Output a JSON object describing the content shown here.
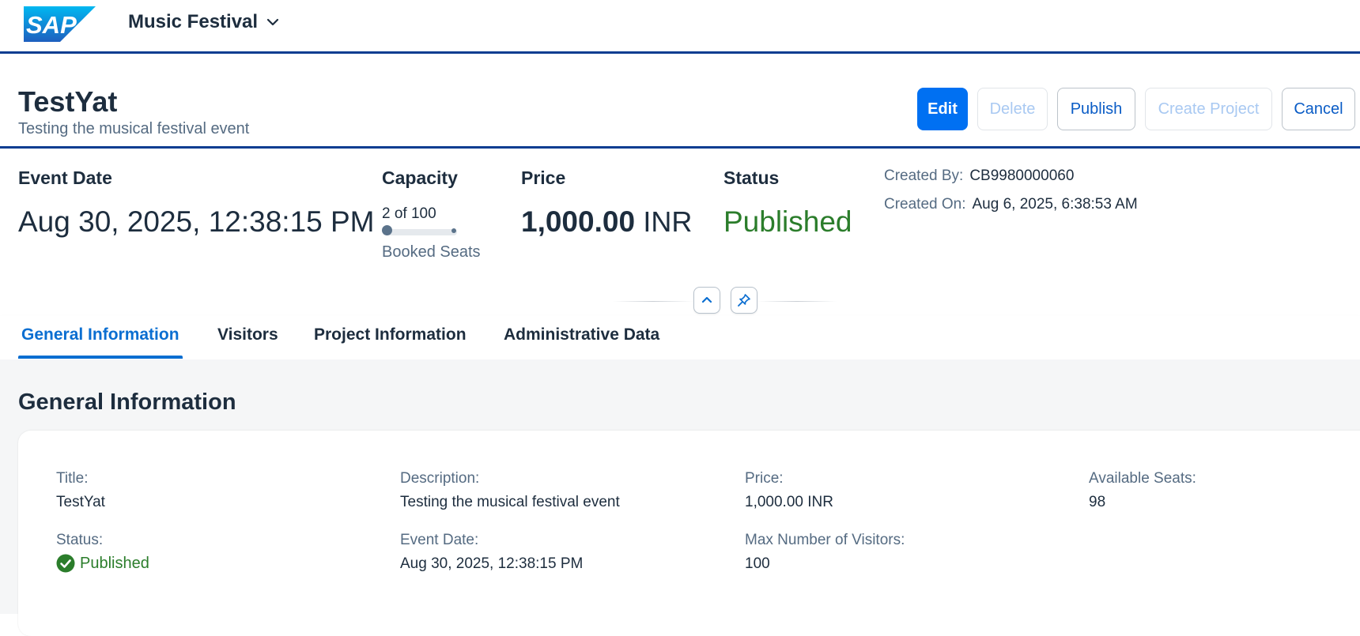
{
  "shell": {
    "logo_text": "SAP",
    "app_title": "Music Festival"
  },
  "header": {
    "title": "TestYat",
    "subtitle": "Testing the musical festival event",
    "actions": {
      "edit": "Edit",
      "delete": "Delete",
      "publish": "Publish",
      "create_project": "Create Project",
      "cancel": "Cancel"
    }
  },
  "kpis": {
    "event_date": {
      "label": "Event Date",
      "value": "Aug 30, 2025, 12:38:15 PM"
    },
    "capacity": {
      "label": "Capacity",
      "text": "2 of 100",
      "booked": 2,
      "total": 100,
      "sublabel": "Booked Seats"
    },
    "price": {
      "label": "Price",
      "amount": "1,000.00",
      "currency": "INR"
    },
    "status": {
      "label": "Status",
      "value": "Published"
    },
    "created_by": {
      "label": "Created By:",
      "value": "CB9980000060"
    },
    "created_on": {
      "label": "Created On:",
      "value": "Aug 6, 2025, 6:38:53 AM"
    }
  },
  "tabs": [
    {
      "label": "General Information",
      "active": true
    },
    {
      "label": "Visitors",
      "active": false
    },
    {
      "label": "Project Information",
      "active": false
    },
    {
      "label": "Administrative Data",
      "active": false
    }
  ],
  "general": {
    "section_title": "General Information",
    "title": {
      "label": "Title:",
      "value": "TestYat"
    },
    "description": {
      "label": "Description:",
      "value": "Testing the musical festival event"
    },
    "price": {
      "label": "Price:",
      "value": "1,000.00 INR"
    },
    "available_seats": {
      "label": "Available Seats:",
      "value": "98"
    },
    "status": {
      "label": "Status:",
      "value": "Published"
    },
    "event_date": {
      "label": "Event Date:",
      "value": "Aug 30, 2025, 12:38:15 PM"
    },
    "max_visitors": {
      "label": "Max Number of Visitors:",
      "value": "100"
    }
  },
  "colors": {
    "brand_blue": "#0070f2",
    "header_border": "#0a3d91",
    "positive_green": "#2b7d2b",
    "link_blue": "#0a6ed1"
  },
  "icons": [
    "sap-logo",
    "chevron-down-icon",
    "chevron-up-icon",
    "pin-icon",
    "success-check-icon"
  ]
}
